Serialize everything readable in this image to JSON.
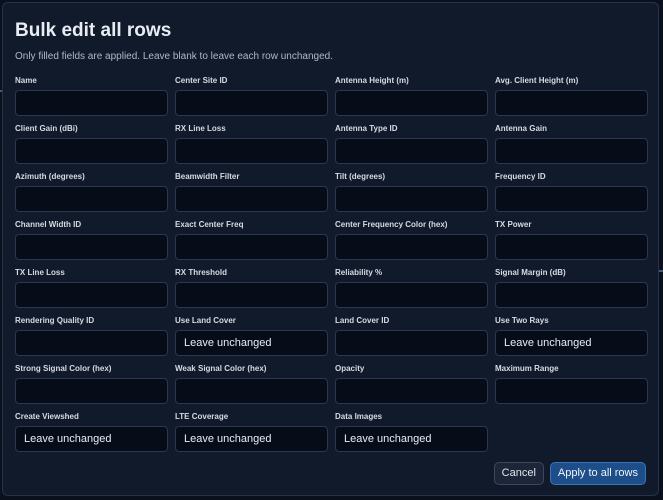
{
  "dialog": {
    "title": "Bulk edit all rows",
    "subtitle": "Only filled fields are applied. Leave blank to leave each row unchanged."
  },
  "fields": [
    {
      "name": "name",
      "label": "Name",
      "kind": "input",
      "value": ""
    },
    {
      "name": "center-site-id",
      "label": "Center Site ID",
      "kind": "input",
      "value": ""
    },
    {
      "name": "antenna-height",
      "label": "Antenna Height (m)",
      "kind": "input",
      "value": ""
    },
    {
      "name": "avg-client-height",
      "label": "Avg. Client Height (m)",
      "kind": "input",
      "value": ""
    },
    {
      "name": "client-gain",
      "label": "Client Gain (dBi)",
      "kind": "input",
      "value": ""
    },
    {
      "name": "rx-line-loss",
      "label": "RX Line Loss",
      "kind": "input",
      "value": ""
    },
    {
      "name": "antenna-type-id",
      "label": "Antenna Type ID",
      "kind": "input",
      "value": ""
    },
    {
      "name": "antenna-gain",
      "label": "Antenna Gain",
      "kind": "input",
      "value": ""
    },
    {
      "name": "azimuth",
      "label": "Azimuth (degrees)",
      "kind": "input",
      "value": ""
    },
    {
      "name": "beamwidth-filter",
      "label": "Beamwidth Filter",
      "kind": "input",
      "value": ""
    },
    {
      "name": "tilt",
      "label": "Tilt (degrees)",
      "kind": "input",
      "value": ""
    },
    {
      "name": "frequency-id",
      "label": "Frequency ID",
      "kind": "input",
      "value": ""
    },
    {
      "name": "channel-width-id",
      "label": "Channel Width ID",
      "kind": "input",
      "value": ""
    },
    {
      "name": "exact-center-freq",
      "label": "Exact Center Freq",
      "kind": "input",
      "value": ""
    },
    {
      "name": "center-frequency-color",
      "label": "Center Frequency Color (hex)",
      "kind": "input",
      "value": ""
    },
    {
      "name": "tx-power",
      "label": "TX Power",
      "kind": "input",
      "value": ""
    },
    {
      "name": "tx-line-loss",
      "label": "TX Line Loss",
      "kind": "input",
      "value": ""
    },
    {
      "name": "rx-threshold",
      "label": "RX Threshold",
      "kind": "input",
      "value": ""
    },
    {
      "name": "reliability",
      "label": "Reliability %",
      "kind": "input",
      "value": ""
    },
    {
      "name": "signal-margin",
      "label": "Signal Margin (dB)",
      "kind": "input",
      "value": ""
    },
    {
      "name": "rendering-quality-id",
      "label": "Rendering Quality ID",
      "kind": "input",
      "value": ""
    },
    {
      "name": "use-land-cover",
      "label": "Use Land Cover",
      "kind": "select",
      "value": "Leave unchanged"
    },
    {
      "name": "land-cover-id",
      "label": "Land Cover ID",
      "kind": "input",
      "value": ""
    },
    {
      "name": "use-two-rays",
      "label": "Use Two Rays",
      "kind": "select",
      "value": "Leave unchanged"
    },
    {
      "name": "strong-signal-color",
      "label": "Strong Signal Color (hex)",
      "kind": "input",
      "value": ""
    },
    {
      "name": "weak-signal-color",
      "label": "Weak Signal Color (hex)",
      "kind": "input",
      "value": ""
    },
    {
      "name": "opacity",
      "label": "Opacity",
      "kind": "input",
      "value": ""
    },
    {
      "name": "maximum-range",
      "label": "Maximum Range",
      "kind": "input",
      "value": ""
    },
    {
      "name": "create-viewshed",
      "label": "Create Viewshed",
      "kind": "select",
      "value": "Leave unchanged"
    },
    {
      "name": "lte-coverage",
      "label": "LTE Coverage",
      "kind": "select",
      "value": "Leave unchanged"
    },
    {
      "name": "data-images",
      "label": "Data Images",
      "kind": "select",
      "value": "Leave unchanged"
    }
  ],
  "actions": {
    "cancel_label": "Cancel",
    "apply_label": "Apply to all rows"
  },
  "colors": {
    "dialog_bg": "#111a2a",
    "input_bg": "#070d18",
    "accent": "#1d4e89"
  }
}
